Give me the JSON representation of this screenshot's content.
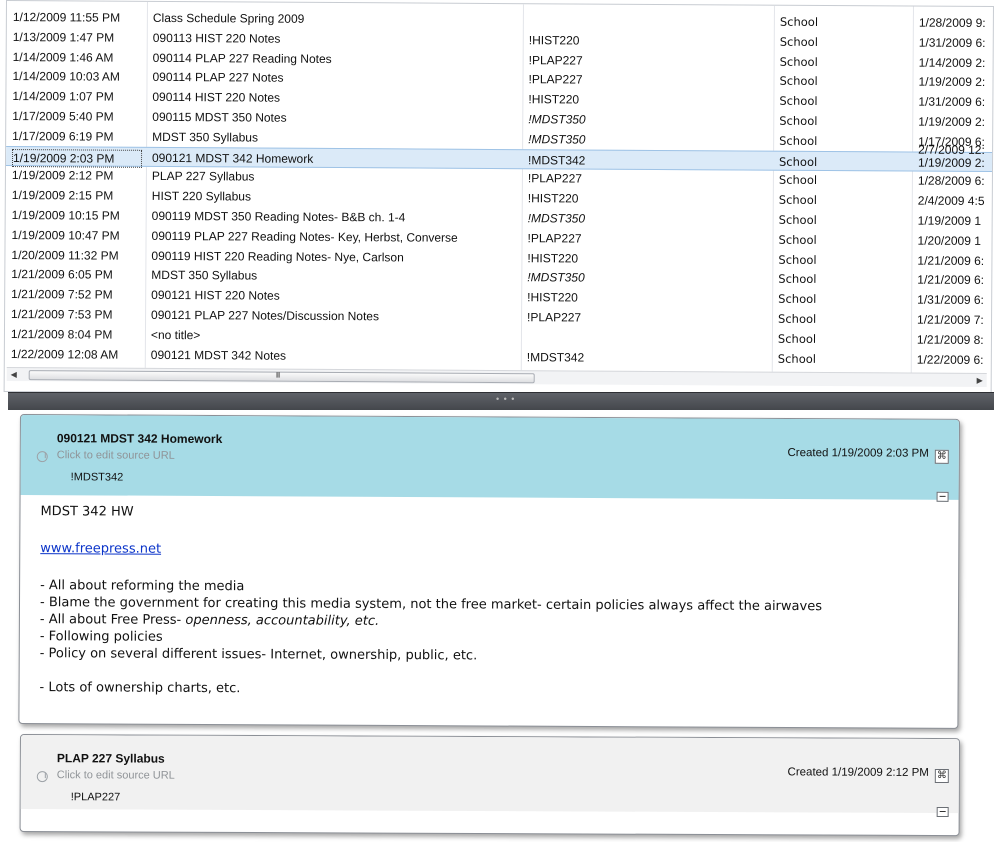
{
  "note_list": {
    "rows": [
      {
        "created": "1/12/2009 11:55 PM",
        "title": "Class Schedule Spring 2009",
        "tag": "",
        "notebook": "School",
        "updated": "1/28/2009 9:"
      },
      {
        "created": "1/13/2009 1:47 PM",
        "title": "090113 HIST 220 Notes",
        "tag": "!HIST220",
        "notebook": "School",
        "updated": "1/31/2009 6:"
      },
      {
        "created": "1/14/2009 1:46 AM",
        "title": "090114 PLAP 227 Reading Notes",
        "tag": "!PLAP227",
        "notebook": "School",
        "updated": "1/14/2009 2:"
      },
      {
        "created": "1/14/2009 10:03 AM",
        "title": "090114 PLAP 227 Notes",
        "tag": "!PLAP227",
        "notebook": "School",
        "updated": "1/19/2009 2:"
      },
      {
        "created": "1/14/2009 1:07 PM",
        "title": "090114 HIST 220 Notes",
        "tag": "!HIST220",
        "notebook": "School",
        "updated": "1/31/2009 6:"
      },
      {
        "created": "1/17/2009 5:40 PM",
        "title": "090115 MDST 350 Notes",
        "tag": "!MDST350",
        "notebook": "School",
        "updated": "1/19/2009 2:"
      },
      {
        "created": "1/17/2009 6:19 PM",
        "title": "MDST 350 Syllabus",
        "tag": "!MDST350",
        "notebook": "School",
        "updated": "1/17/2009 6:"
      },
      {
        "created": "1/19/2009 2:03 PM",
        "title": "090121 MDST 342 Homework",
        "tag": "!MDST342",
        "notebook": "School",
        "updated": "1/19/2009 2:"
      },
      {
        "created": "1/19/2009 2:12 PM",
        "title": "PLAP 227 Syllabus",
        "tag": "!PLAP227",
        "notebook": "School",
        "updated": "1/28/2009 6:"
      },
      {
        "created": "1/19/2009 2:15 PM",
        "title": "HIST 220 Syllabus",
        "tag": "!HIST220",
        "notebook": "School",
        "updated": "2/4/2009 4:5"
      },
      {
        "created": "1/19/2009 10:15 PM",
        "title": "090119 MDST 350 Reading Notes- B&B ch. 1-4",
        "tag": "!MDST350",
        "notebook": "School",
        "updated": "1/19/2009 1"
      },
      {
        "created": "1/19/2009 10:47 PM",
        "title": "090119 PLAP 227 Reading Notes- Key, Herbst, Converse",
        "tag": "!PLAP227",
        "notebook": "School",
        "updated": "1/20/2009 1"
      },
      {
        "created": "1/20/2009 11:32 PM",
        "title": "090119 HIST 220 Reading Notes- Nye, Carlson",
        "tag": "!HIST220",
        "notebook": "School",
        "updated": "1/21/2009 6:"
      },
      {
        "created": "1/21/2009 6:05 PM",
        "title": "MDST 350 Syllabus",
        "tag": "!MDST350",
        "notebook": "School",
        "updated": "1/21/2009 6:"
      },
      {
        "created": "1/21/2009 7:52 PM",
        "title": "090121 HIST 220 Notes",
        "tag": "!HIST220",
        "notebook": "School",
        "updated": "1/31/2009 6:"
      },
      {
        "created": "1/21/2009 7:53 PM",
        "title": "090121 PLAP 227 Notes/Discussion Notes",
        "tag": "!PLAP227",
        "notebook": "School",
        "updated": "1/21/2009 7:"
      },
      {
        "created": "1/21/2009 8:04 PM",
        "title": "<no title>",
        "tag": "",
        "notebook": "School",
        "updated": "1/21/2009 8:"
      },
      {
        "created": "1/22/2009 12:08 AM",
        "title": "090121 MDST 342 Notes",
        "tag": "!MDST342",
        "notebook": "School",
        "updated": "1/22/2009 6:"
      }
    ],
    "second_column_updated": "2/7/2009 12:",
    "scroll_grip": "III"
  },
  "notes": [
    {
      "title": "090121 MDST 342 Homework",
      "source_url_hint": "Click to edit source URL",
      "tag": "!MDST342",
      "created": "Created 1/19/2009 2:03 PM",
      "body": {
        "heading": "MDST 342 HW",
        "link": "www.freepress.net",
        "lines": [
          "- All about reforming the media",
          "- Blame the government for creating this media system, not the free market- certain policies always affect the airwaves",
          "- All about Free Press- ",
          "- Following policies",
          "- Policy on several different issues- Internet, ownership, public, etc.",
          "- Lots of ownership charts, etc."
        ],
        "line3_emphasis": "openness, accountability, etc."
      }
    },
    {
      "title": "PLAP 227 Syllabus",
      "source_url_hint": "Click to edit source URL",
      "tag": "!PLAP227",
      "created": "Created 1/19/2009 2:12 PM"
    }
  ],
  "colors": {
    "selected_row": "#dbeaf8",
    "active_note_header": "#a6dbe6",
    "link": "#0b34c9"
  }
}
